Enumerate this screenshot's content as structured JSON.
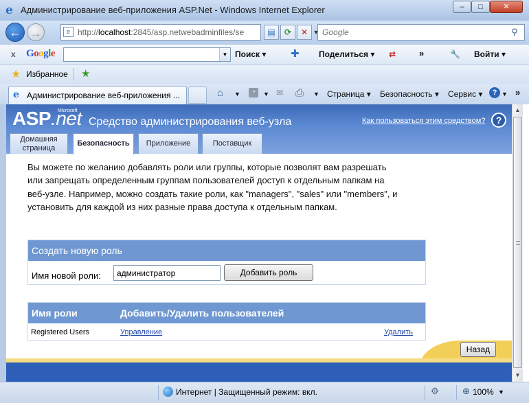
{
  "window": {
    "title": "Администрирование веб-приложения ASP.Net - Windows Internet Explorer",
    "min_glyph": "–",
    "max_glyph": "□",
    "close_glyph": "✕"
  },
  "nav": {
    "url_prefix": "http://",
    "url_host": "localhost",
    "url_rest": ":2845/asp.netwebadminfiles/se",
    "search_placeholder": "Google"
  },
  "google_toolbar": {
    "logo_letters": [
      "G",
      "o",
      "o",
      "g",
      "l",
      "e"
    ],
    "search_label": "Поиск ▾",
    "share_label": "Поделиться ▾",
    "more": "»",
    "login_label": "Войти ▾"
  },
  "favorites": {
    "label": "Избранное"
  },
  "tabs": {
    "active_tab_label": "Администрирование веб-приложения ..."
  },
  "command_bar": {
    "page_label": "Страница ▾",
    "safety_label": "Безопасность ▾",
    "service_label": "Сервис ▾",
    "more": "»"
  },
  "asp": {
    "logo_asp": "ASP",
    "logo_net": ".net",
    "microsoft": "Microsoft",
    "title": "Средство администрирования веб-узла",
    "help_link": "Как пользоваться этим средством?",
    "help_icon": "?",
    "tabs": [
      {
        "label": "Домашняя страница"
      },
      {
        "label": "Безопасность"
      },
      {
        "label": "Приложение"
      },
      {
        "label": "Поставщик"
      }
    ]
  },
  "page": {
    "intro": "Вы можете по желанию добавлять роли или группы, которые позволят вам разрешать или запрещать определенным группам пользователей доступ к отдельным папкам на веб-узле. Например, можно создать такие роли, как \"managers\", \"sales\" или \"members\", и установить для каждой из них разные права доступа к отдельным папкам.",
    "create_role": {
      "heading": "Создать новую роль",
      "input_label": "Имя новой роли:",
      "input_value": "администратор",
      "button_label": "Добавить роль"
    },
    "roles_table": {
      "columns": [
        "Имя роли",
        "Добавить/Удалить пользователей"
      ],
      "rows": [
        {
          "name": "Registered Users",
          "manage": "Управление",
          "delete": "Удалить"
        }
      ]
    },
    "back_button": "Назад"
  },
  "status": {
    "zone": "Интернет | Защищенный режим: вкл.",
    "zoom": "100%"
  }
}
